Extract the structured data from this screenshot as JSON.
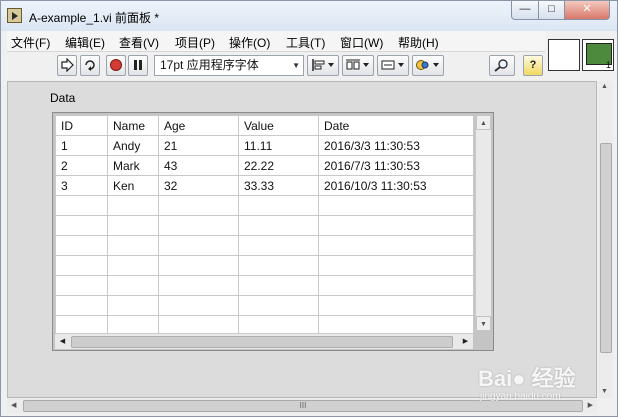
{
  "window": {
    "title": "A-example_1.vi 前面板 *",
    "minimize_glyph": "—",
    "maximize_glyph": "□",
    "close_glyph": "✕"
  },
  "menu": {
    "items": [
      {
        "label": "文件(F)"
      },
      {
        "label": "编辑(E)"
      },
      {
        "label": "查看(V)"
      },
      {
        "label": "项目(P)"
      },
      {
        "label": "操作(O)"
      },
      {
        "label": "工具(T)"
      },
      {
        "label": "窗口(W)"
      },
      {
        "label": "帮助(H)"
      }
    ]
  },
  "toolbar": {
    "font_value": "17pt 应用程序字体",
    "run_icon": "run-arrow-icon",
    "run_continuous_icon": "run-continuously-icon",
    "abort_icon": "abort-icon",
    "pause_icon": "pause-icon",
    "align_icon": "align-objects-icon",
    "distribute_icon": "distribute-objects-icon",
    "resize_icon": "resize-objects-icon",
    "reorder_icon": "reorder-icon",
    "search_icon": "search-icon",
    "help_icon": "context-help-icon",
    "help_glyph": "?"
  },
  "panel": {
    "data_label": "Data",
    "table": {
      "columns": [
        "ID",
        "Name",
        "Age",
        "Value",
        "Date"
      ],
      "rows": [
        [
          "1",
          "Andy",
          "21",
          "11.11",
          "2016/3/3 11:30:53"
        ],
        [
          "2",
          "Mark",
          "43",
          "22.22",
          "2016/7/3 11:30:53"
        ],
        [
          "3",
          "Ken",
          "32",
          "33.33",
          "2016/10/3 11:30:53"
        ],
        [
          "",
          "",
          "",
          "",
          ""
        ],
        [
          "",
          "",
          "",
          "",
          ""
        ],
        [
          "",
          "",
          "",
          "",
          ""
        ],
        [
          "",
          "",
          "",
          "",
          ""
        ],
        [
          "",
          "",
          "",
          "",
          ""
        ],
        [
          "",
          "",
          "",
          "",
          ""
        ],
        [
          "",
          "",
          "",
          "",
          ""
        ]
      ]
    }
  },
  "watermark": {
    "main": "Bai● 经验",
    "sub": "jingyan.baidu.com"
  },
  "colors": {
    "close_button": "#d9796a",
    "connector_green": "#4d8a3e",
    "abort_red": "#d23c32"
  }
}
